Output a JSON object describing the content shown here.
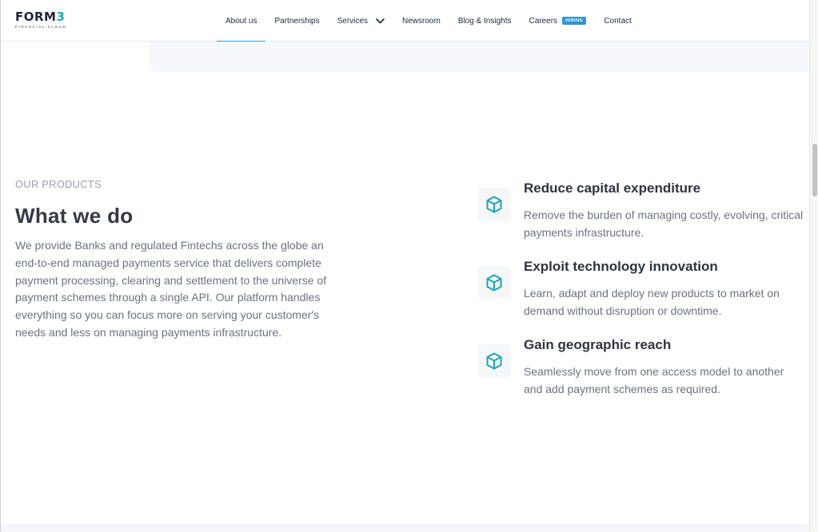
{
  "brand": {
    "name_main": "FORM",
    "name_accent": "3",
    "tagline": "FINANCIAL CLOUD",
    "accent_color": "#1aa7b8"
  },
  "nav": {
    "items": [
      {
        "label": "About us",
        "active": true
      },
      {
        "label": "Partnerships"
      },
      {
        "label": "Services",
        "has_dropdown": true
      },
      {
        "label": "Newsroom"
      },
      {
        "label": "Blog & Insights"
      },
      {
        "label": "Careers",
        "badge": "HIRING"
      },
      {
        "label": "Contact"
      }
    ],
    "active_color": "#2c9fd6",
    "badge_color": "#2f93d8"
  },
  "section": {
    "eyebrow": "OUR PRODUCTS",
    "title": "What we do",
    "description": "We provide Banks and regulated Fintechs across the globe an end-to-end managed payments service that delivers complete payment processing, clearing and settlement to the universe of payment schemes through a single API. Our platform handles everything so you can focus more on serving your customer's needs and less on managing payments infrastructure."
  },
  "features": [
    {
      "icon": "cube-icon",
      "title": "Reduce capital expenditure",
      "description": "Remove the burden of managing costly, evolving, critical payments infrastructure."
    },
    {
      "icon": "cube-icon",
      "title": "Exploit technology innovation",
      "description": "Learn, adapt and deploy new products to market on demand without disruption or downtime."
    },
    {
      "icon": "cube-icon",
      "title": "Gain geographic reach",
      "description": "Seamlessly move from one access model to another and add payment schemes as required."
    }
  ]
}
